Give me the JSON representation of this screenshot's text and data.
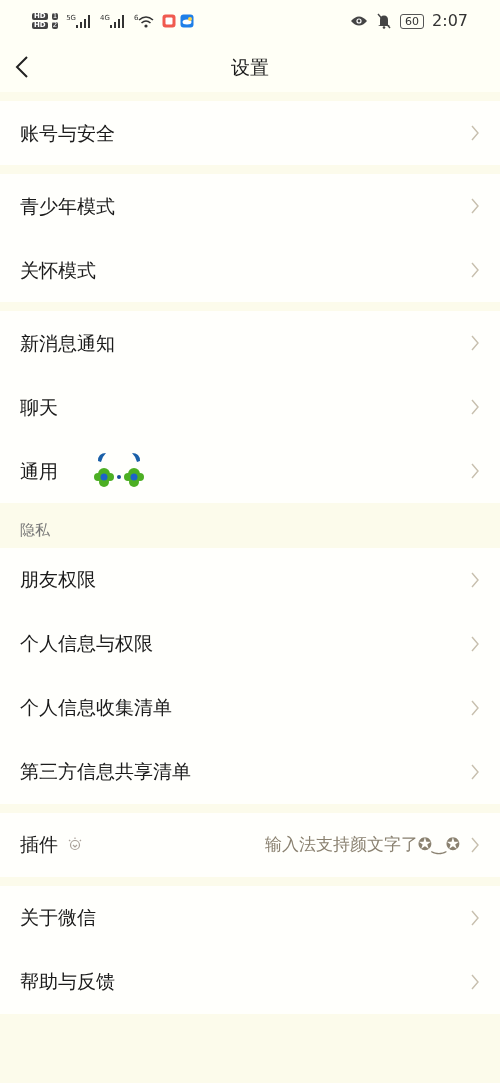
{
  "status_bar": {
    "sims": [
      {
        "label": "HD",
        "slot": "1"
      },
      {
        "label": "HD",
        "slot": "2"
      }
    ],
    "networks": [
      {
        "label": "5G"
      },
      {
        "label": "4G"
      }
    ],
    "wifi": "6",
    "battery": "60",
    "time": "2:07"
  },
  "header": {
    "title": "设置"
  },
  "groups": [
    {
      "items": [
        {
          "label": "账号与安全",
          "kind": "plain"
        }
      ]
    },
    {
      "items": [
        {
          "label": "青少年模式",
          "kind": "plain"
        },
        {
          "label": "关怀模式",
          "kind": "plain"
        }
      ]
    },
    {
      "items": [
        {
          "label": "新消息通知",
          "kind": "plain"
        },
        {
          "label": "聊天",
          "kind": "plain"
        },
        {
          "label": "通用",
          "kind": "emoji"
        }
      ]
    },
    {
      "header": "隐私",
      "items": [
        {
          "label": "朋友权限",
          "kind": "plain"
        },
        {
          "label": "个人信息与权限",
          "kind": "plain"
        },
        {
          "label": "个人信息收集清单",
          "kind": "plain"
        },
        {
          "label": "第三方信息共享清单",
          "kind": "plain"
        }
      ]
    },
    {
      "items": [
        {
          "label": "插件",
          "kind": "hint",
          "hint": "输入法支持颜文字了✪‿✪"
        }
      ]
    },
    {
      "items": [
        {
          "label": "关于微信",
          "kind": "plain"
        },
        {
          "label": "帮助与反馈",
          "kind": "plain"
        }
      ]
    }
  ]
}
